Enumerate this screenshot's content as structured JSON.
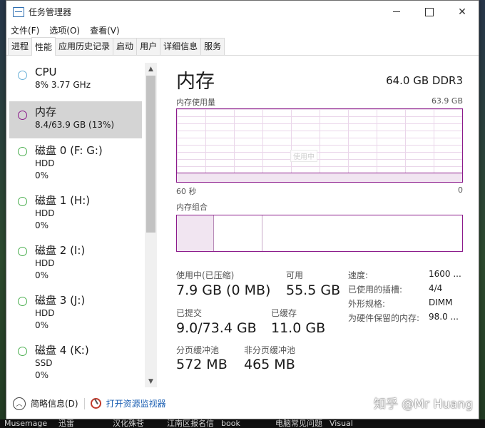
{
  "taskbar": [
    "Musemage",
    "迅雷",
    "汉化殊苍",
    "江南区报名信",
    "book",
    "电脑常见问题",
    "Visual",
    ""
  ],
  "window": {
    "title": "任务管理器",
    "menu": [
      "文件(F)",
      "选项(O)",
      "查看(V)"
    ],
    "tabs": [
      "进程",
      "性能",
      "应用历史记录",
      "启动",
      "用户",
      "详细信息",
      "服务"
    ],
    "active_tab": "性能"
  },
  "sidebar": {
    "items": [
      {
        "name": "CPU",
        "line1": "8% 3.77 GHz",
        "line2": "",
        "color": "#6bb1d8"
      },
      {
        "name": "内存",
        "line1": "8.4/63.9 GB (13%)",
        "line2": "",
        "color": "#8b1a8b"
      },
      {
        "name": "磁盘 0 (F: G:)",
        "line1": "HDD",
        "line2": "0%",
        "color": "#4caf50"
      },
      {
        "name": "磁盘 1 (H:)",
        "line1": "HDD",
        "line2": "0%",
        "color": "#4caf50"
      },
      {
        "name": "磁盘 2 (I:)",
        "line1": "HDD",
        "line2": "0%",
        "color": "#4caf50"
      },
      {
        "name": "磁盘 3 (J:)",
        "line1": "HDD",
        "line2": "0%",
        "color": "#4caf50"
      },
      {
        "name": "磁盘 4 (K:)",
        "line1": "SSD",
        "line2": "0%",
        "color": "#4caf50"
      }
    ],
    "selected_index": 1
  },
  "memory": {
    "heading": "内存",
    "spec": "64.0 GB DDR3",
    "usage_label": "内存使用量",
    "usage_max": "63.9 GB",
    "graph_watermark": "使用中",
    "time_left": "60 秒",
    "time_right": "0",
    "usage_level": 0.13,
    "composition_label": "内存组合",
    "composition": {
      "in_use_fraction": 0.13,
      "modified_fraction": 0.17
    },
    "stats": {
      "in_use_label": "使用中(已压缩)",
      "in_use_value": "7.9 GB (0 MB)",
      "available_label": "可用",
      "available_value": "55.5 GB",
      "committed_label": "已提交",
      "committed_value": "9.0/73.4 GB",
      "cached_label": "已缓存",
      "cached_value": "11.0 GB",
      "paged_label": "分页缓冲池",
      "paged_value": "572 MB",
      "nonpaged_label": "非分页缓冲池",
      "nonpaged_value": "465 MB"
    },
    "specs": [
      {
        "label": "速度:",
        "value": "1600 ..."
      },
      {
        "label": "已使用的插槽:",
        "value": "4/4"
      },
      {
        "label": "外形规格:",
        "value": "DIMM"
      },
      {
        "label": "为硬件保留的内存:",
        "value": "98.0 ..."
      }
    ]
  },
  "footer": {
    "fewer_details": "简略信息(D)",
    "open_monitor": "打开资源监视器"
  },
  "watermark": "知乎 @Mr Huang"
}
